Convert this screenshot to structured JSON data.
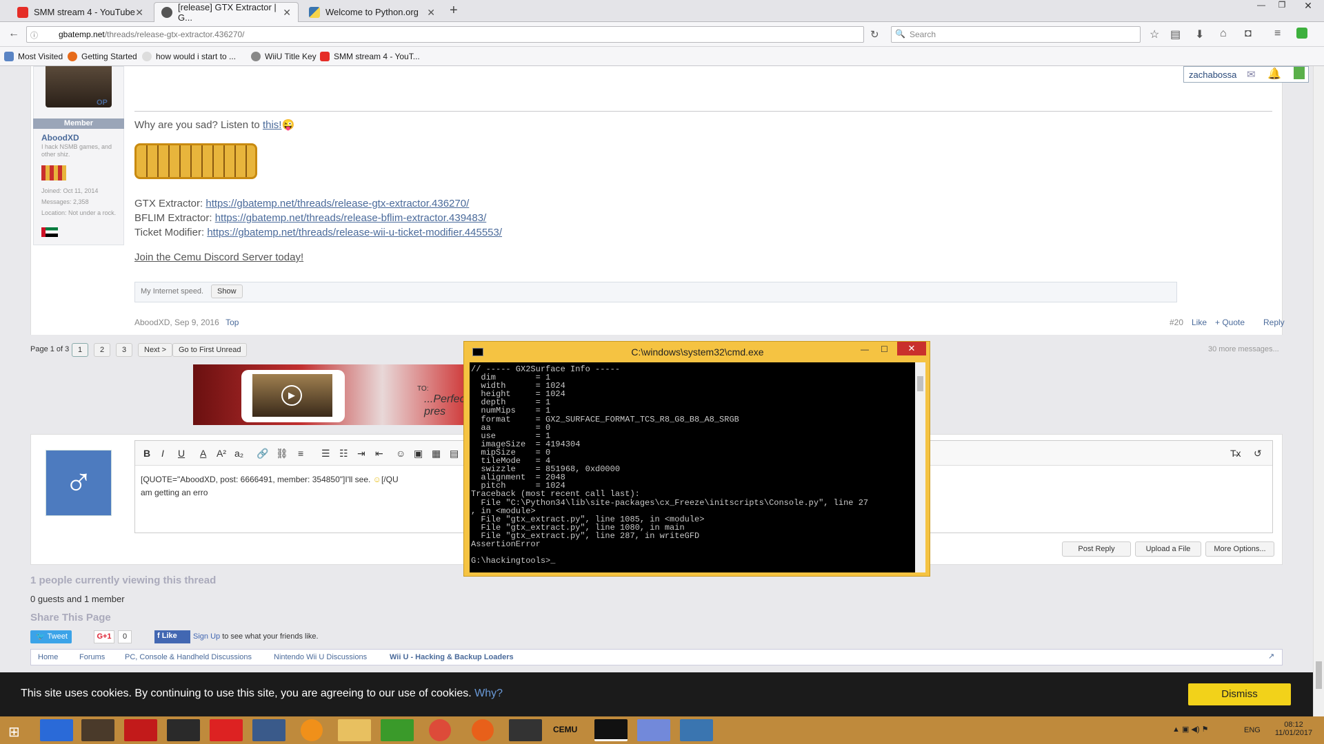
{
  "browser": {
    "tabs": [
      {
        "label": "SMM stream 4 - YouTube"
      },
      {
        "label": "[release] GTX Extractor | G..."
      },
      {
        "label": "Welcome to Python.org"
      }
    ],
    "url_domain": "gbatemp.net",
    "url_path": "/threads/release-gtx-extractor.436270/",
    "search_placeholder": "Search",
    "bookmarks": [
      "Most Visited",
      "Getting Started",
      "how would i start to ...",
      "WiiU Title Key",
      "SMM stream 4 - YouT..."
    ]
  },
  "user_panel": {
    "username": "zachabossa"
  },
  "post": {
    "op_badge": "OP",
    "member_label": "Member",
    "author": "AboodXD",
    "author_sub": "I hack NSMB games, and other shiz.",
    "joined_label": "Joined:",
    "joined": "Oct 11, 2014",
    "messages_label": "Messages:",
    "messages": "2,358",
    "location_label": "Location:",
    "location": "Not under a rock.",
    "sig_text": "Why are you sad? Listen to ",
    "sig_link": "this!",
    "links": [
      {
        "label": "GTX Extractor: ",
        "url": "https://gbatemp.net/threads/release-gtx-extractor.436270/"
      },
      {
        "label": "BFLIM Extractor: ",
        "url": "https://gbatemp.net/threads/release-bflim-extractor.439483/"
      },
      {
        "label": "Ticket Modifier: ",
        "url": "https://gbatemp.net/threads/release-wii-u-ticket-modifier.445553/"
      }
    ],
    "discord": "Join the Cemu Discord Server today!",
    "spoiler_label": "My Internet speed.",
    "spoiler_button": "Show",
    "meta": "AboodXD, Sep 9, 2016",
    "top_link": "Top",
    "number": "#20",
    "like": "Like",
    "quote": "+ Quote",
    "reply": "Reply"
  },
  "pagination": {
    "label": "Page 1 of 3",
    "pages": [
      "1",
      "2",
      "3"
    ],
    "next": "Next >",
    "first_unread": "Go to First Unread",
    "more": "30 more messages..."
  },
  "ad": {
    "to": "TO:",
    "text": "...Perfect pres"
  },
  "editor": {
    "line1": "[QUOTE=\"AboodXD, post: 6666491, member: 354850\"]I'll see. ",
    "line1_end": "[/QU",
    "line2": "am getting an erro",
    "toolbar": [
      "B",
      "I",
      "U",
      "A",
      "A²",
      "a₂",
      "🔗",
      "⛓",
      "≡",
      "☰",
      "☷",
      "⇥",
      "⇤",
      "☺",
      "▣",
      "▦",
      "▤",
      "T̶x",
      "↺"
    ],
    "post_reply": "Post Reply",
    "upload": "Upload a File",
    "more_options": "More Options..."
  },
  "cmd": {
    "title": "C:\\windows\\system32\\cmd.exe",
    "lines": [
      "// ----- GX2Surface Info -----",
      "  dim        = 1",
      "  width      = 1024",
      "  height     = 1024",
      "  depth      = 1",
      "  numMips    = 1",
      "  format     = GX2_SURFACE_FORMAT_TCS_R8_G8_B8_A8_SRGB",
      "  aa         = 0",
      "  use        = 1",
      "  imageSize  = 4194304",
      "  mipSize    = 0",
      "  tileMode   = 4",
      "  swizzle    = 851968, 0xd0000",
      "  alignment  = 2048",
      "  pitch      = 1024",
      "Traceback (most recent call last):",
      "  File \"C:\\Python34\\lib\\site-packages\\cx_Freeze\\initscripts\\Console.py\", line 27",
      ", in <module>",
      "  File \"gtx_extract.py\", line 1085, in <module>",
      "  File \"gtx_extract.py\", line 1080, in main",
      "  File \"gtx_extract.py\", line 287, in writeGFD",
      "AssertionError",
      "",
      "G:\\hackingtools>_"
    ]
  },
  "footer": {
    "viewing": "1 people currently viewing this thread",
    "guests": "0 guests and 1 member",
    "share": "Share This Page",
    "tweet": "Tweet",
    "gplus": "G+1",
    "gplus_count": "0",
    "fb_like": "Like",
    "fb_text_link": "Sign Up",
    "fb_text": " to see what your friends like.",
    "crumbs": [
      "Home",
      "Forums",
      "PC, Console & Handheld Discussions",
      "Nintendo Wii U Discussions",
      "Wii U - Hacking & Backup Loaders"
    ]
  },
  "cookie": {
    "text": "This site uses cookies. By continuing to use this site, you are agreeing to our use of cookies. ",
    "why": "Why?",
    "dismiss": "Dismiss"
  },
  "taskbar": {
    "lang": "ENG",
    "time": "08:12",
    "date": "11/01/2017",
    "cemu": "CEMU"
  }
}
